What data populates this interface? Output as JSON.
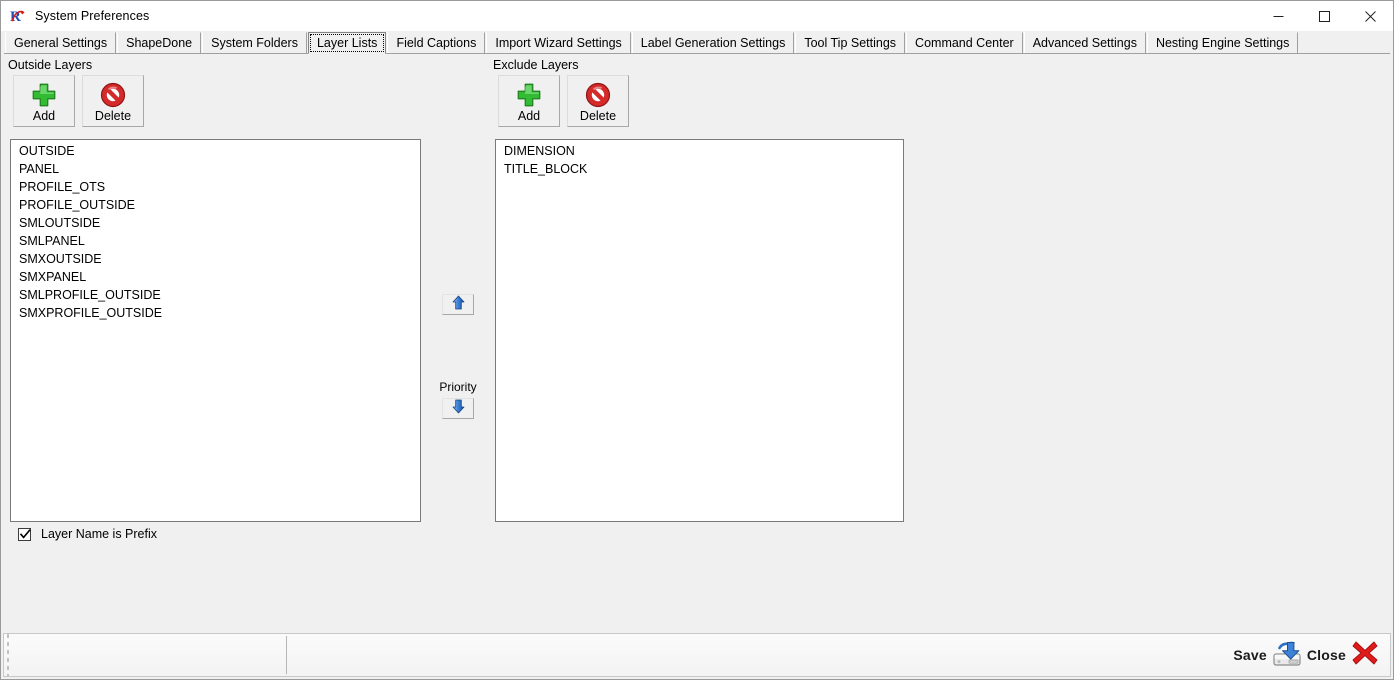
{
  "window": {
    "title": "System Preferences",
    "app_icon": "app-logo-icon",
    "controls": {
      "minimize": "minimize-icon",
      "maximize": "maximize-icon",
      "close": "close-icon"
    }
  },
  "tabs": [
    {
      "label": "General Settings",
      "active": false
    },
    {
      "label": "ShapeDone",
      "active": false
    },
    {
      "label": "System Folders",
      "active": false
    },
    {
      "label": "Layer Lists",
      "active": true
    },
    {
      "label": "Field Captions",
      "active": false
    },
    {
      "label": "Import Wizard Settings",
      "active": false
    },
    {
      "label": "Label Generation Settings",
      "active": false
    },
    {
      "label": "Tool Tip Settings",
      "active": false
    },
    {
      "label": "Command Center",
      "active": false
    },
    {
      "label": "Advanced Settings",
      "active": false
    },
    {
      "label": "Nesting Engine Settings",
      "active": false
    }
  ],
  "outside_layers": {
    "group_label": "Outside Layers",
    "add_button": {
      "label": "Add",
      "icon": "green-plus-icon"
    },
    "delete_button": {
      "label": "Delete",
      "icon": "red-no-entry-icon"
    },
    "items": [
      "OUTSIDE",
      "PANEL",
      "PROFILE_OTS",
      "PROFILE_OUTSIDE",
      "SMLOUTSIDE",
      "SMLPANEL",
      "SMXOUTSIDE",
      "SMXPANEL",
      "SMLPROFILE_OUTSIDE",
      "SMXPROFILE_OUTSIDE"
    ]
  },
  "exclude_layers": {
    "group_label": "Exclude Layers",
    "add_button": {
      "label": "Add",
      "icon": "green-plus-icon"
    },
    "delete_button": {
      "label": "Delete",
      "icon": "red-no-entry-icon"
    },
    "items": [
      "DIMENSION",
      "TITLE_BLOCK"
    ]
  },
  "priority": {
    "label": "Priority",
    "up_icon": "arrow-up-icon",
    "down_icon": "arrow-down-icon"
  },
  "options": {
    "layer_name_is_prefix": {
      "label": "Layer Name is Prefix",
      "checked": true
    }
  },
  "statusbar": {
    "save": {
      "label": "Save",
      "icon": "save-disk-icon"
    },
    "close": {
      "label": "Close",
      "icon": "red-x-icon"
    }
  },
  "colors": {
    "window_bg": "#f0f0f0",
    "titlebar_bg": "#ffffff",
    "list_bg": "#ffffff",
    "border": "#7a7a7a",
    "accent_green": "#2eb82e",
    "accent_red": "#cc1111",
    "accent_blue": "#2b6fcf",
    "text": "#000000"
  }
}
